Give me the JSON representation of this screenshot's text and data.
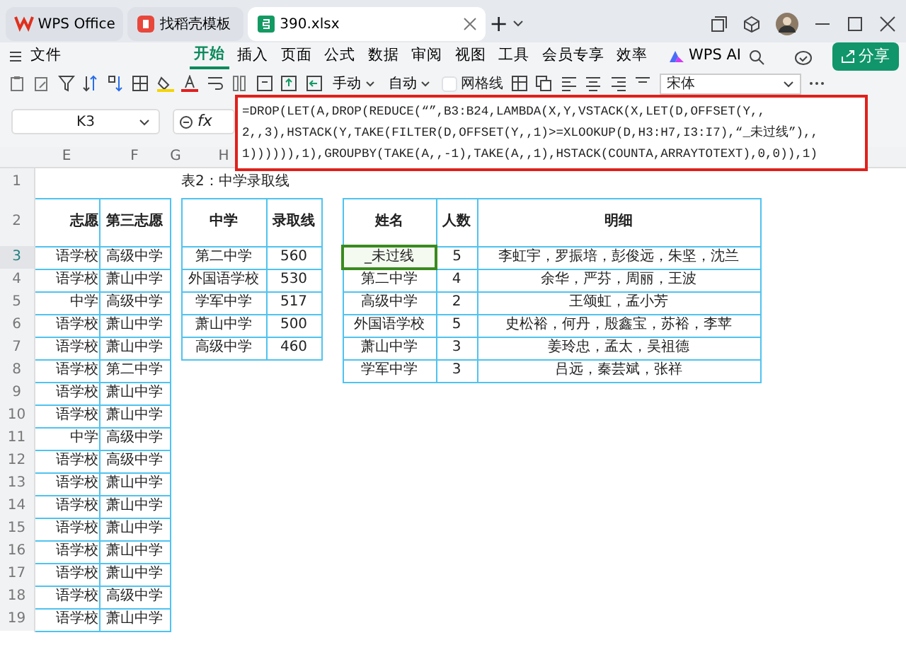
{
  "tabs": [
    {
      "label": "WPS Office",
      "kind": "home",
      "selected": false
    },
    {
      "label": "找稻壳模板",
      "kind": "template",
      "selected": false
    },
    {
      "label": "390.xlsx",
      "kind": "sheet",
      "selected": true
    }
  ],
  "add_tab": "+",
  "menu": [
    {
      "label": "开始",
      "selected": true
    },
    {
      "label": "插入",
      "selected": false
    },
    {
      "label": "页面",
      "selected": false
    },
    {
      "label": "公式",
      "selected": false
    },
    {
      "label": "数据",
      "selected": false
    },
    {
      "label": "审阅",
      "selected": false
    },
    {
      "label": "视图",
      "selected": false
    },
    {
      "label": "工具",
      "selected": false
    },
    {
      "label": "会员专享",
      "selected": false
    },
    {
      "label": "效率",
      "selected": false
    }
  ],
  "file_menu": "文件",
  "ai_button": "WPS AI",
  "share_button": "分享",
  "toolbar": {
    "dropdowns": [
      "手动",
      "自动"
    ],
    "gridlines": {
      "label": "网格线",
      "checked": false
    },
    "font": "宋体"
  },
  "name_box": "K3",
  "fx_label": "fx",
  "formula_lines": [
    "=DROP(LET(A,DROP(REDUCE(“”,B3:B24,LAMBDA(X,Y,VSTACK(X,LET(D,OFFSET(Y,,",
    "2,,3),HSTACK(Y,TAKE(FILTER(D,OFFSET(Y,,1)>=XLOOKUP(D,H3:H7,I3:I7),“_未过线”),,",
    "1)))))),1),GROUPBY(TAKE(A,,-1),TAKE(A,,1),HSTACK(COUNTA,ARRAYTOTEXT),0,0)),1)"
  ],
  "columns": [
    "E",
    "F",
    "G",
    "H"
  ],
  "row_numbers": [
    {
      "number": "1",
      "selected": false
    },
    {
      "number": "2",
      "selected": false
    },
    {
      "number": "3",
      "selected": true
    },
    {
      "number": "4",
      "selected": false
    },
    {
      "number": "5",
      "selected": false
    },
    {
      "number": "6",
      "selected": false
    },
    {
      "number": "7",
      "selected": false
    },
    {
      "number": "8",
      "selected": false
    },
    {
      "number": "9",
      "selected": false
    },
    {
      "number": "10",
      "selected": false
    },
    {
      "number": "11",
      "selected": false
    },
    {
      "number": "12",
      "selected": false
    },
    {
      "number": "13",
      "selected": false
    },
    {
      "number": "14",
      "selected": false
    },
    {
      "number": "15",
      "selected": false
    },
    {
      "number": "16",
      "selected": false
    },
    {
      "number": "17",
      "selected": false
    },
    {
      "number": "18",
      "selected": false
    },
    {
      "number": "19",
      "selected": false
    }
  ],
  "sheet_title": "表2：中学录取线",
  "table1": {
    "columns": [
      "志愿",
      "第三志愿"
    ],
    "rows": [
      [
        "语学校",
        "高级中学"
      ],
      [
        "语学校",
        "萧山中学"
      ],
      [
        "中学",
        "高级中学"
      ],
      [
        "语学校",
        "萧山中学"
      ],
      [
        "语学校",
        "萧山中学"
      ],
      [
        "语学校",
        "第二中学"
      ],
      [
        "语学校",
        "萧山中学"
      ],
      [
        "语学校",
        "萧山中学"
      ],
      [
        "中学",
        "高级中学"
      ],
      [
        "语学校",
        "高级中学"
      ],
      [
        "语学校",
        "萧山中学"
      ],
      [
        "语学校",
        "萧山中学"
      ],
      [
        "语学校",
        "萧山中学"
      ],
      [
        "语学校",
        "萧山中学"
      ],
      [
        "语学校",
        "萧山中学"
      ],
      [
        "语学校",
        "高级中学"
      ],
      [
        "语学校",
        "萧山中学"
      ]
    ]
  },
  "table2": {
    "columns": [
      "中学",
      "录取线"
    ],
    "rows": [
      [
        "第二中学",
        "560"
      ],
      [
        "外国语学校",
        "530"
      ],
      [
        "学军中学",
        "517"
      ],
      [
        "萧山中学",
        "500"
      ],
      [
        "高级中学",
        "460"
      ]
    ]
  },
  "table3": {
    "columns": [
      "姓名",
      "人数",
      "明细"
    ],
    "rows": [
      {
        "cells": [
          "_未过线",
          "5",
          "李虹宇，罗振培，彭俊远，朱坚，沈兰"
        ],
        "selected": true
      },
      {
        "cells": [
          "第二中学",
          "4",
          "余华，严芬，周丽，王波"
        ],
        "selected": false
      },
      {
        "cells": [
          "高级中学",
          "2",
          "王颂虹，孟小芳"
        ],
        "selected": false
      },
      {
        "cells": [
          "外国语学校",
          "5",
          "史松裕，何丹，殷鑫宝，苏裕，李苹"
        ],
        "selected": false
      },
      {
        "cells": [
          "萧山中学",
          "3",
          "姜玲忠，孟太，吴祖德"
        ],
        "selected": false
      },
      {
        "cells": [
          "学军中学",
          "3",
          "吕远，秦芸斌，张祥"
        ],
        "selected": false
      }
    ]
  }
}
